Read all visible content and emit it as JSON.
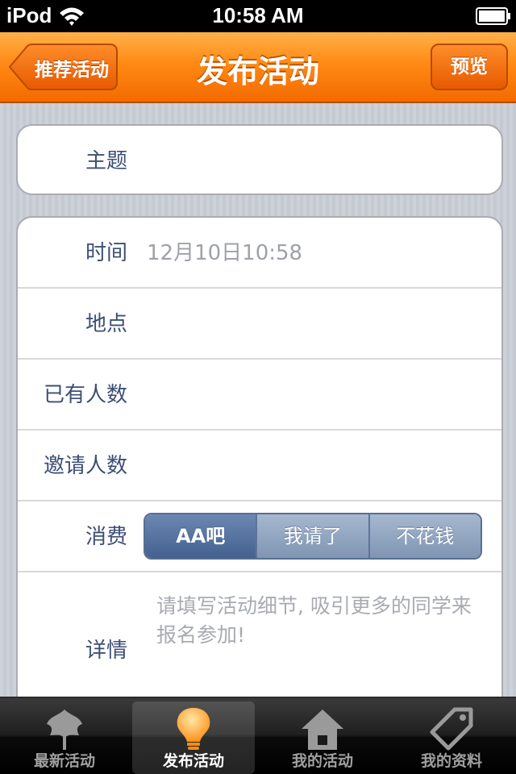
{
  "status_bar": {
    "carrier": "iPod",
    "time": "10:58 AM"
  },
  "nav": {
    "back_label": "推荐活动",
    "title": "发布活动",
    "preview_label": "预览"
  },
  "form": {
    "subject_label": "主题",
    "time_label": "时间",
    "time_value": "12月10日10:58",
    "place_label": "地点",
    "existing_count_label": "已有人数",
    "invite_count_label": "邀请人数",
    "cost_label": "消费",
    "cost_options": [
      "AA吧",
      "我请了",
      "不花钱"
    ],
    "cost_selected": "AA吧",
    "details_label": "详情",
    "details_placeholder": "请填写活动细节, 吸引更多的同学来报名参加!"
  },
  "tab_bar": {
    "tabs": [
      {
        "label": "最新活动",
        "icon": "leaf-icon"
      },
      {
        "label": "发布活动",
        "icon": "lightbulb-icon"
      },
      {
        "label": "我的活动",
        "icon": "home-icon"
      },
      {
        "label": "我的资料",
        "icon": "tag-icon"
      }
    ],
    "active": "发布活动"
  },
  "colors": {
    "nav_orange": "#ff8a14",
    "label_blue": "#3d4f75",
    "segment_active": "#44618f"
  }
}
